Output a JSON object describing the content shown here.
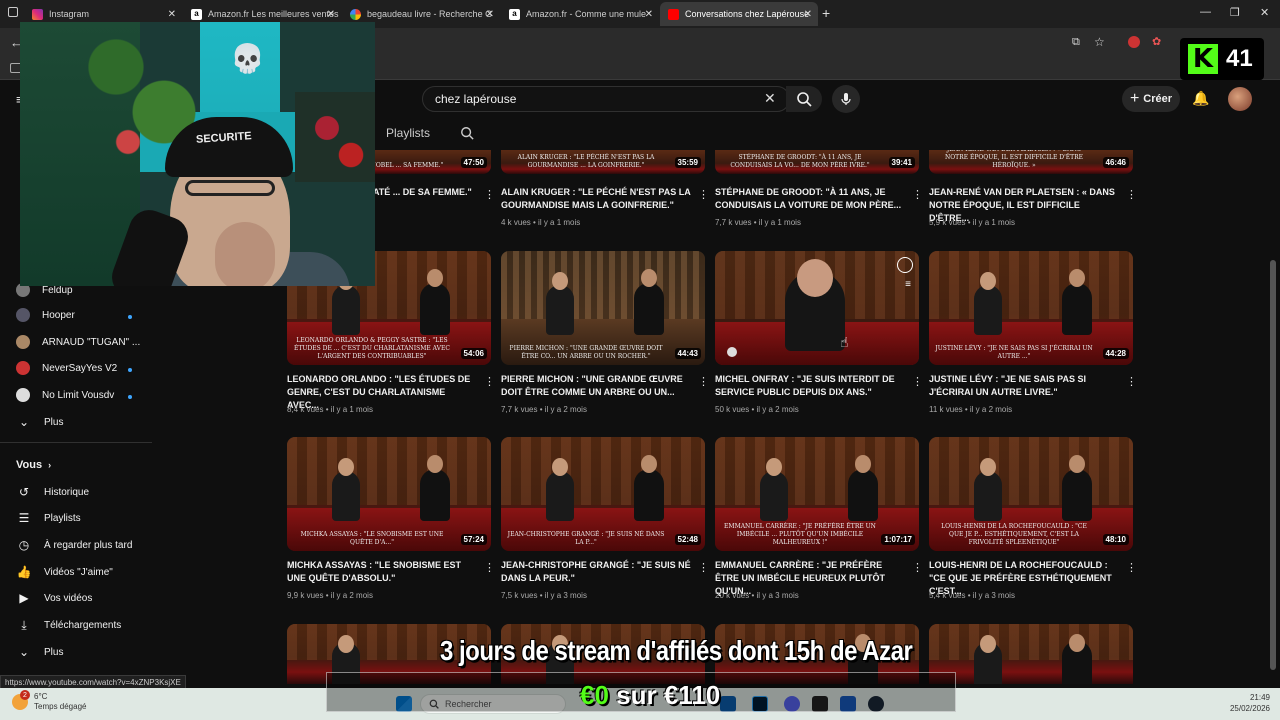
{
  "browser": {
    "tabs": [
      {
        "label": "Instagram",
        "color": "#d6249f"
      },
      {
        "label": "Amazon.fr Les meilleures ventes",
        "color": "#ffffff"
      },
      {
        "label": "begaudeau livre - Recherche G",
        "color": "#4285f4"
      },
      {
        "label": "Amazon.fr - Comme une mule",
        "color": "#ffffff"
      },
      {
        "label": "Conversations chez Lapérouse",
        "color": "#ff0000"
      }
    ],
    "status_url": "https://www.youtube.com/watch?v=4xZNP3KsjXE"
  },
  "youtube": {
    "search_value": "chez lapérouse",
    "create_label": "Créer",
    "channel_tabs": [
      "Playlists"
    ],
    "subscriptions": [
      {
        "name": "Feldup",
        "live": false,
        "color": "#888"
      },
      {
        "name": "Hooper",
        "live": true,
        "color": "#556"
      },
      {
        "name": "ARNAUD \"TUGAN\" ...",
        "live": false,
        "color": "#a86"
      },
      {
        "name": "NeverSayYes V2",
        "live": true,
        "color": "#c33"
      },
      {
        "name": "No Limit Vousdv",
        "live": true,
        "color": "#ddd"
      }
    ],
    "subs_more": "Plus",
    "you_heading": "Vous",
    "you_items": [
      "Historique",
      "Playlists",
      "À regarder plus tard",
      "Vidéos \"J'aime\"",
      "Vos vidéos",
      "Téléchargements",
      "Plus"
    ],
    "videos_row0": [
      {
        "title": "...\"PHILIP ROTH A RATÉ ... DE SA FEMME.\"",
        "meta": "",
        "duration": "47:50",
        "caption": "...IP ROTH A RATÉ LE NOBEL ... SA FEMME.\""
      },
      {
        "title": "ALAIN KRUGER : \"LE PÉCHÉ N'EST PAS LA GOURMANDISE MAIS LA GOINFRERIE.\"",
        "meta": "4 k vues • il y a 1 mois",
        "duration": "35:59",
        "caption": "ALAIN KRUGER : \"LE PÉCHÉ N'EST PAS LA GOURMANDISE ... LA GOINFRERIE.\""
      },
      {
        "title": "STÉPHANE DE GROODT: \"À 11 ANS, JE CONDUISAIS LA VOITURE DE MON PÈRE...",
        "meta": "7,7 k vues • il y a 1 mois",
        "duration": "39:41",
        "caption": "STÉPHANE DE GROODT: \"À 11 ANS, JE CONDUISAIS LA VO... DE MON PÈRE IVRE.\""
      },
      {
        "title": "JEAN-RENÉ VAN DER PLAETSEN : « DANS NOTRE ÉPOQUE, IL EST DIFFICILE D'ÊTRE...",
        "meta": "5,9 k vues • il y a 1 mois",
        "duration": "46:46",
        "caption": "JEAN-RENÉ VAN DER PLAETSEN : « DANS NOTRE ÉPOQUE, IL EST DIFFICILE D'ÊTRE HÉROÏQUE. »"
      }
    ],
    "videos_row1": [
      {
        "title": "LEONARDO ORLANDO : \"LES ÉTUDES DE GENRE, C'EST DU CHARLATANISME AVEC...",
        "meta": "8,4 k vues • il y a 1 mois",
        "duration": "54:06",
        "caption": "LEONARDO ORLANDO & PEGGY SASTRE : \"LES ÉTUDES DE ... C'EST DU CHARLATANISME AVEC L'ARGENT DES CONTRIBUABLES\""
      },
      {
        "title": "PIERRE MICHON : \"UNE GRANDE ŒUVRE DOIT ÊTRE COMME UN ARBRE OU UN...",
        "meta": "7,7 k vues • il y a 2 mois",
        "duration": "44:43",
        "caption": "PIERRE MICHON : \"UNE GRANDE ŒUVRE DOIT ÊTRE CO... UN ARBRE OU UN ROCHER.\""
      },
      {
        "title": "MICHEL ONFRAY : \"JE SUIS INTERDIT DE SERVICE PUBLIC DEPUIS DIX ANS.\"",
        "meta": "50 k vues • il y a 2 mois",
        "duration": "",
        "caption": ""
      },
      {
        "title": "JUSTINE LÉVY : \"JE NE SAIS PAS SI J'ÉCRIRAI UN AUTRE LIVRE.\"",
        "meta": "11 k vues • il y a 2 mois",
        "duration": "44:28",
        "caption": "JUSTINE LÉVY : \"JE NE SAIS PAS SI J'ÉCRIRAI UN AUTRE ...\""
      }
    ],
    "videos_row2": [
      {
        "title": "MICHKA ASSAYAS : \"LE SNOBISME EST UNE QUÊTE D'ABSOLU.\"",
        "meta": "9,9 k vues • il y a 2 mois",
        "duration": "57:24",
        "caption": "MICHKA ASSAYAS : \"LE SNOBISME EST UNE QUÊTE D'A...\""
      },
      {
        "title": "JEAN-CHRISTOPHE GRANGÉ : \"JE SUIS NÉ DANS LA PEUR.\"",
        "meta": "7,5 k vues • il y a 3 mois",
        "duration": "52:48",
        "caption": "JEAN-CHRISTOPHE GRANGÉ : \"JE SUIS NÉ DANS LA P...\""
      },
      {
        "title": "EMMANUEL CARRÈRE : \"JE PRÉFÈRE ÊTRE UN IMBÉCILE HEUREUX PLUTÔT QU'UN...",
        "meta": "20 k vues • il y a 3 mois",
        "duration": "1:07:17",
        "caption": "EMMANUEL CARRÈRE : \"JE PRÉFÈRE ÊTRE UN IMBÉCILE ... PLUTÔT QU'UN IMBÉCILE MALHEUREUX !\""
      },
      {
        "title": "LOUIS-HENRI DE LA ROCHEFOUCAULD : \"CE QUE JE PRÉFÈRE ESTHÉTIQUEMENT C'EST...",
        "meta": "5,4 k vues • il y a 3 mois",
        "duration": "48:10",
        "caption": "LOUIS-HENRI DE LA ROCHEFOUCAULD : \"CE QUE JE P... ESTHÉTIQUEMENT, C'EST LA FRIVOLITÉ SPLEENÉTIQUE\""
      }
    ]
  },
  "stream": {
    "webcam_cap_text": "SECURITE",
    "kick_count": "41",
    "kick_letter": "K",
    "overlay_text": "3 jours de stream d'affilés dont 15h de Azar",
    "donation_current": "€0",
    "donation_sep": " sur ",
    "donation_goal": "€110"
  },
  "taskbar": {
    "temp": "6°C",
    "weather": "Temps dégagé",
    "weather_badge": "2",
    "search_placeholder": "Rechercher",
    "time": "21:49",
    "date": "25/02/2026"
  }
}
